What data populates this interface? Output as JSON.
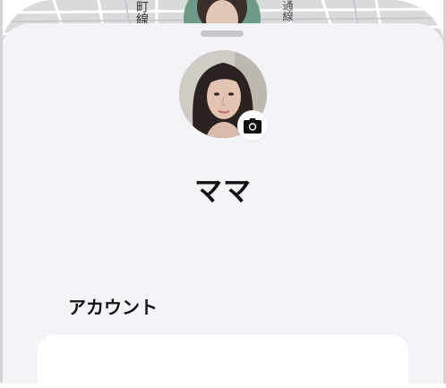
{
  "profile": {
    "name": "ママ"
  },
  "sections": {
    "account_title": "アカウント"
  },
  "map": {
    "street_labels": [
      "町線",
      "通線"
    ]
  },
  "icons": {
    "camera": "camera-icon",
    "grabber": "drag-handle"
  },
  "colors": {
    "sheet_background": "#f3f4f8",
    "card_background": "#ffffff",
    "grabber": "#c6c7cc",
    "text": "#111111"
  }
}
